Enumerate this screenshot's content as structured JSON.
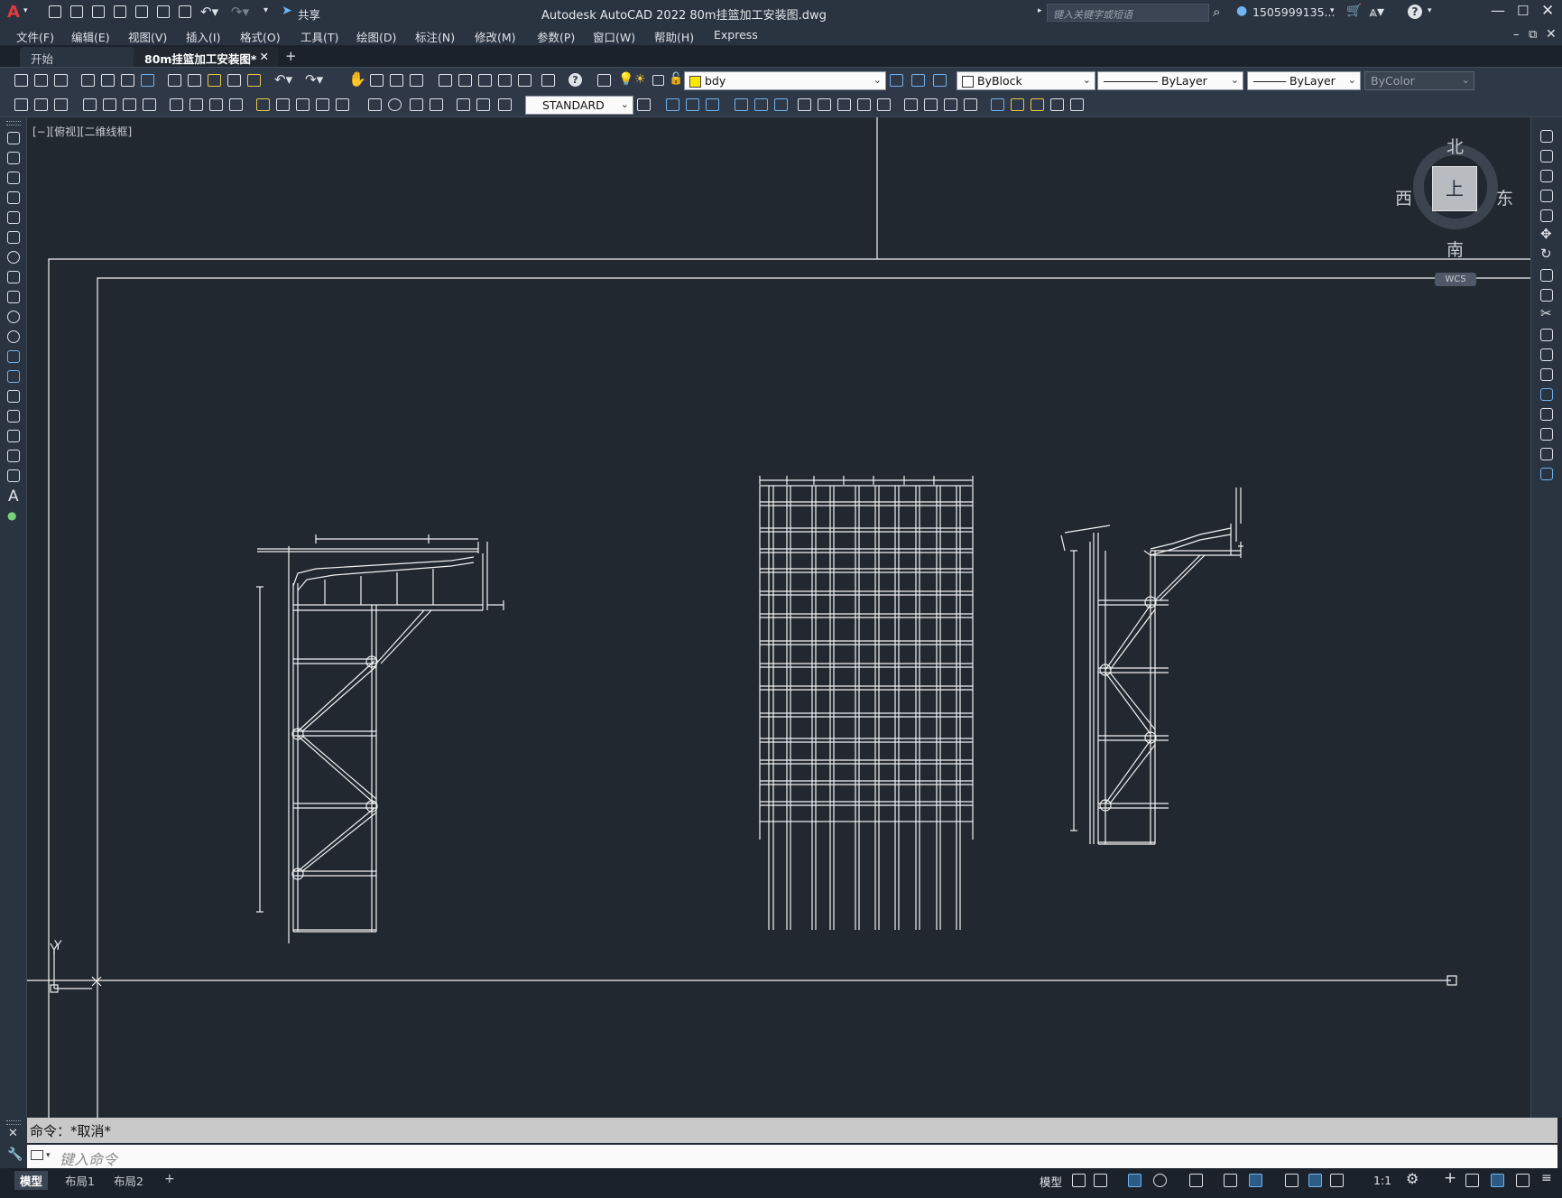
{
  "app": {
    "logo_letter": "A",
    "title": "Autodesk AutoCAD 2022    80m挂篮加工安装图.dwg",
    "search_placeholder": "键入关键字或短语",
    "user": "1505999135...",
    "share_label": "共享"
  },
  "menu": [
    "文件(F)",
    "编辑(E)",
    "视图(V)",
    "插入(I)",
    "格式(O)",
    "工具(T)",
    "绘图(D)",
    "标注(N)",
    "修改(M)",
    "参数(P)",
    "窗口(W)",
    "帮助(H)",
    "Express"
  ],
  "tabs": {
    "start": "开始",
    "active": "80m挂篮加工安装图*",
    "close": "✕",
    "add": "+"
  },
  "toolbar": {
    "layer": "bdy",
    "color": "ByBlock",
    "linetype": "ByLayer",
    "lineweight": "ByLayer",
    "plotstyle": "ByColor",
    "text_style": "STANDARD"
  },
  "viewport": {
    "label": "[−][俯视][二维线框]",
    "compass": {
      "north": "北",
      "south": "南",
      "east": "东",
      "west": "西",
      "face": "上"
    },
    "wcs": "WCS",
    "ucs_y": "Y"
  },
  "command": {
    "history": "命令：*取消*",
    "input_placeholder": "键入命令"
  },
  "status": {
    "tabs": [
      "模型",
      "布局1",
      "布局2"
    ],
    "add_tab": "+",
    "model_label": "模型",
    "scale": "1:1"
  },
  "colors": {
    "canvas": "#212830",
    "chrome": "#2a3340",
    "accent": "#6fb3f0",
    "logo": "#e23b3b",
    "layer_swatch": "#ffe600"
  }
}
